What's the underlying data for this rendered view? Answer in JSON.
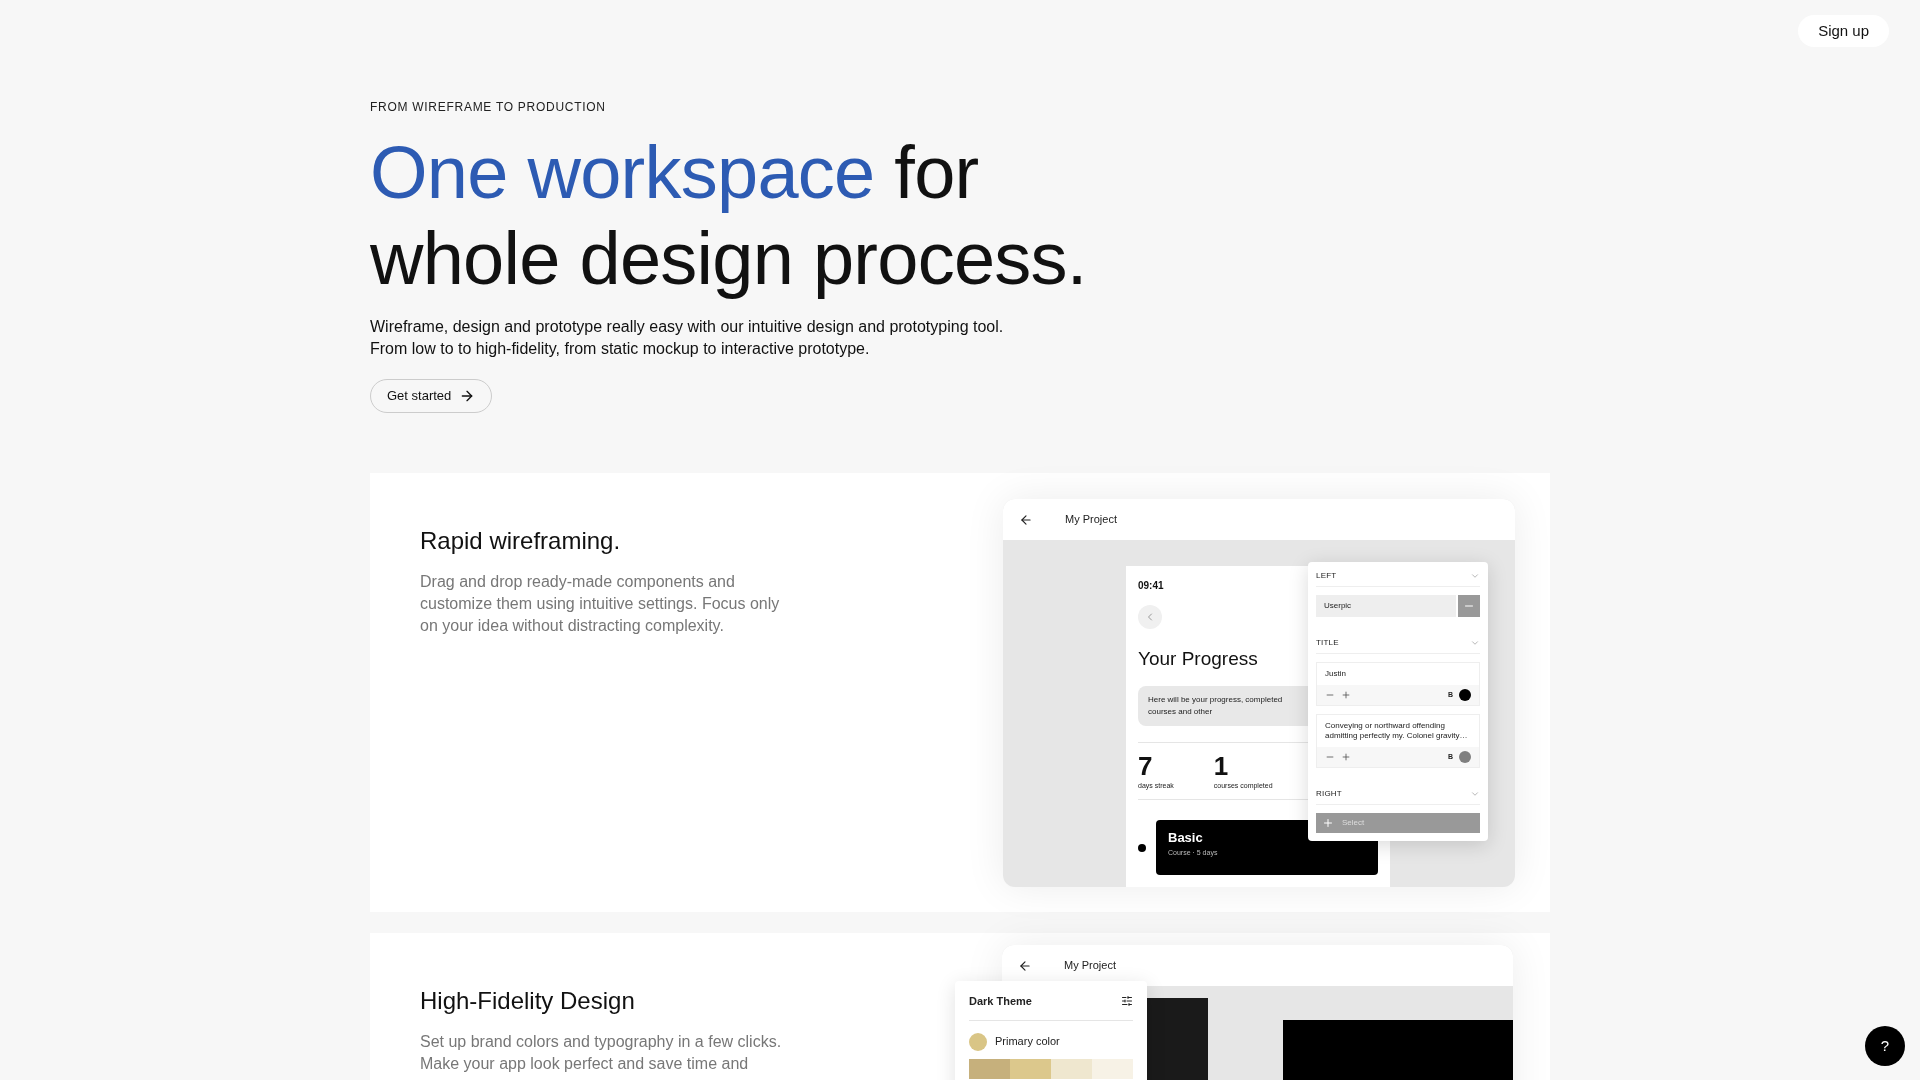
{
  "nav": {
    "signup": "Sign up"
  },
  "hero": {
    "eyebrow": "FROM WIREFRAME TO PRODUCTION",
    "headline_highlight": "One workspace",
    "headline_line_1_rest": "for",
    "headline_line_2": "whole design process.",
    "description": [
      "Wireframe, design and prototype really easy with our intuitive design and prototyping tool.",
      "From low to to high-fidelity, from static mockup to interactive prototype."
    ],
    "cta": "Get started"
  },
  "features": [
    {
      "kind": "wireframe",
      "title": "Rapid wireframing.",
      "description": "Drag and drop ready-made components and customize them using intuitive settings. Focus only on your idea without distracting complexity.",
      "mockup": {
        "window_title": "My Project",
        "time": "09:41",
        "heading": "Your Progress",
        "note": "Here will be your progress, completed courses and other",
        "stats": [
          {
            "value": "7",
            "label": "days streak"
          },
          {
            "value": "1",
            "label": "courses completed"
          }
        ],
        "course": {
          "title": "Basic",
          "meta": "Course · 5 days"
        },
        "panel": {
          "left_label": "LEFT",
          "left_field": "Userpic",
          "title_label": "TITLE",
          "text_blocks": [
            {
              "text": "Justin",
              "bold": "B",
              "color": "#000000"
            },
            {
              "text": "Conveying or northward offending admitting perfectly my. Colonel gravity…",
              "bold": "B",
              "color": "#7f7f7f"
            }
          ],
          "right_label": "RIGHT",
          "select": "Select"
        }
      }
    },
    {
      "kind": "theme",
      "title": "High-Fidelity Design",
      "description": "Set up brand colors and typography in a few clicks. Make your app look perfect and save time and",
      "mockup": {
        "window_title": "My Project",
        "panel_title": "Dark Theme",
        "primary": {
          "label": "Primary color",
          "color": "#d9c586"
        },
        "palette": [
          {
            "color": "#c6b07c"
          },
          {
            "color": "#dcc88c"
          },
          {
            "color": "#efe7cf"
          },
          {
            "color": "#f7f2e6"
          }
        ]
      }
    }
  ],
  "help": "?"
}
